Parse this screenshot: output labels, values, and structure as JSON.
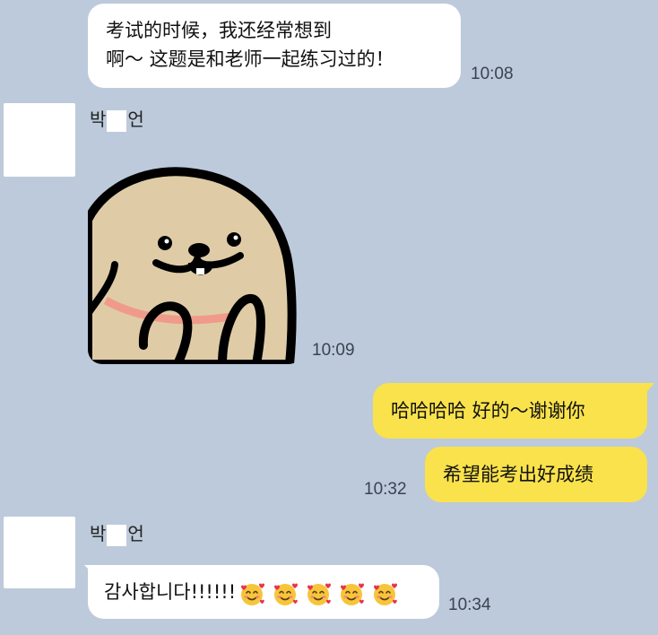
{
  "messages": {
    "m1": {
      "line1": "考试的时候，我还经常想到",
      "line2": "啊～ 这题是和老师一起练习过的！",
      "time": "10:08"
    },
    "sender1": {
      "name_first": "박",
      "name_last": "언"
    },
    "sticker": {
      "time": "10:09"
    },
    "m3": {
      "text": "哈哈哈哈 好的～谢谢你"
    },
    "m4": {
      "text": "希望能考出好成绩",
      "time": "10:32"
    },
    "sender2": {
      "name_first": "박",
      "name_last": "언"
    },
    "m5": {
      "text": "감사합니다!!!!!!",
      "time": "10:34",
      "emoji_count": 5,
      "emoji": "smiling-face-with-hearts-icon"
    }
  },
  "colors": {
    "background": "#bccadb",
    "incoming_bubble": "#ffffff",
    "outgoing_bubble": "#f9e24b",
    "sticker_body": "#dfcca6",
    "sticker_collar": "#f09a8a"
  }
}
